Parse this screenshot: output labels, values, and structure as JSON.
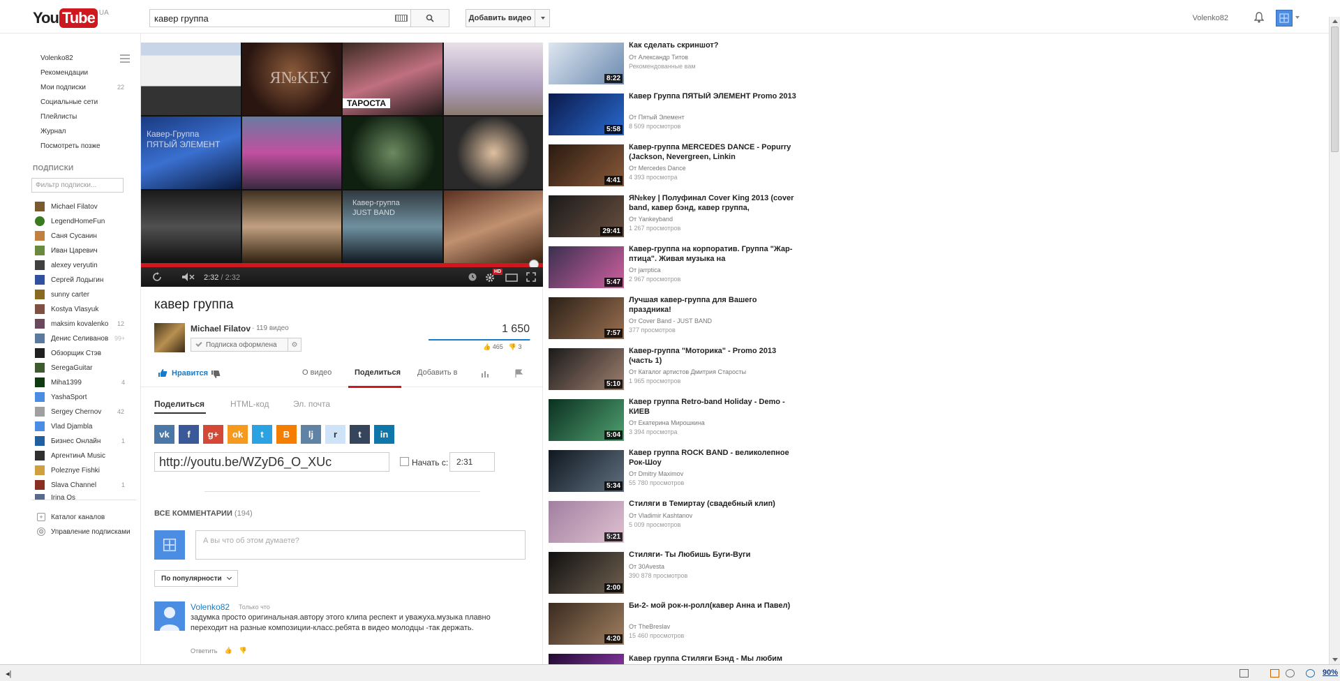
{
  "header": {
    "logo_you": "You",
    "logo_tube": "Tube",
    "logo_country": "UA",
    "search_value": "кавер группа",
    "upload_label": "Добавить видео",
    "username": "Volenko82"
  },
  "sidebar": {
    "nav": [
      {
        "label": "Volenko82",
        "count": ""
      },
      {
        "label": "Рекомендации",
        "count": ""
      },
      {
        "label": "Мои подписки",
        "count": "22"
      },
      {
        "label": "Социальные сети",
        "count": ""
      },
      {
        "label": "Плейлисты",
        "count": ""
      },
      {
        "label": "Журнал",
        "count": ""
      },
      {
        "label": "Посмотреть позже",
        "count": ""
      }
    ],
    "subs_header": "ПОДПИСКИ",
    "subs_filter_placeholder": "Фильтр подписки...",
    "subs": [
      {
        "name": "Michael Filatov",
        "count": "",
        "color": "#7a5a30"
      },
      {
        "name": "LegendHomeFun",
        "count": "",
        "color": "#3a7a20"
      },
      {
        "name": "Саня Сусанин",
        "count": "",
        "color": "#c08040"
      },
      {
        "name": "Иван Царевич",
        "count": "",
        "color": "#6a8a40"
      },
      {
        "name": "alexey veryutin",
        "count": "",
        "color": "#404040"
      },
      {
        "name": "Сергей Лодыгин",
        "count": "",
        "color": "#3050a0"
      },
      {
        "name": "sunny carter",
        "count": "",
        "color": "#8a6a20"
      },
      {
        "name": "Kostya Vlasyuk",
        "count": "",
        "color": "#805040"
      },
      {
        "name": "maksim kovalenko",
        "count": "12",
        "color": "#6a4a5a"
      },
      {
        "name": "Денис Селиванов",
        "count": "99+",
        "color": "#5a7aa0"
      },
      {
        "name": "Обзорщик Стэв",
        "count": "",
        "color": "#202020"
      },
      {
        "name": "SeregaGuitar",
        "count": "",
        "color": "#405a30"
      },
      {
        "name": "Miha1399",
        "count": "4",
        "color": "#103a10"
      },
      {
        "name": "YashaSport",
        "count": "",
        "color": "#4b8de2"
      },
      {
        "name": "Sergey Chernov",
        "count": "42",
        "color": "#a0a0a0"
      },
      {
        "name": "Vlad Djambla",
        "count": "",
        "color": "#4b8de2"
      },
      {
        "name": "Бизнес Онлайн",
        "count": "1",
        "color": "#2060a0"
      },
      {
        "name": "АргентинА Music",
        "count": "",
        "color": "#303030"
      },
      {
        "name": "Poleznye Fishki",
        "count": "",
        "color": "#d0a040"
      },
      {
        "name": "Slava Channel",
        "count": "1",
        "color": "#8a3020"
      },
      {
        "name": "Irina Os",
        "count": "",
        "color": "#5a6a8a"
      }
    ],
    "bottom": [
      {
        "label": "Каталог каналов"
      },
      {
        "label": "Управление подписками"
      }
    ]
  },
  "player": {
    "current_time": "2:32",
    "duration": "/ 2:32",
    "hd_badge": "HD",
    "overlay_1": "Кавер-Группа",
    "overlay_2": "ПЯТЫЙ ЭЛЕМЕНТ",
    "overlay_3": "Кавер-группа",
    "overlay_4": "JUST BAND",
    "overlay_5": "ТАРОСТА",
    "overlay_6": "Я№KEY",
    "progress_fraction": 1.0
  },
  "video": {
    "title": "кавер группа",
    "channel": "Michael Filatov",
    "channel_videos": "· 119 видео",
    "subscribe_label": "Подписка оформлена",
    "views": "1 650",
    "likes": "465",
    "dislikes": "3",
    "like_label": "Нравится",
    "tabs": [
      "О видео",
      "Поделиться",
      "Добавить в"
    ],
    "share_tabs": [
      "Поделиться",
      "HTML-код",
      "Эл. почта"
    ],
    "share_url": "http://youtu.be/WZyD6_O_XUc",
    "start_label": "Начать с:",
    "start_value": "2:31",
    "social": [
      {
        "icon": "vk-icon",
        "glyph": "vk",
        "color": "#4a76a8"
      },
      {
        "icon": "facebook-icon",
        "glyph": "f",
        "color": "#3b5998"
      },
      {
        "icon": "googleplus-icon",
        "glyph": "g+",
        "color": "#d34836"
      },
      {
        "icon": "odnoklassniki-icon",
        "glyph": "ok",
        "color": "#f59a1e"
      },
      {
        "icon": "twitter-icon",
        "glyph": "t",
        "color": "#2ba2e2"
      },
      {
        "icon": "blogger-icon",
        "glyph": "B",
        "color": "#f57d00"
      },
      {
        "icon": "livejournal-icon",
        "glyph": "lj",
        "color": "#6082a5"
      },
      {
        "icon": "reddit-icon",
        "glyph": "r",
        "color": "#cee3f8"
      },
      {
        "icon": "tumblr-icon",
        "glyph": "t",
        "color": "#35465c"
      },
      {
        "icon": "linkedin-icon",
        "glyph": "in",
        "color": "#0e76a8"
      }
    ]
  },
  "comments": {
    "header": "ВСЕ КОММЕНТАРИИ",
    "count": "(194)",
    "placeholder": "А вы что об этом думаете?",
    "sort_label": "По популярности",
    "items": [
      {
        "author": "Volenko82",
        "time": "Только что",
        "text": "задумка просто оригинальная.автору этого клипа респект и уважуха.музыка плавно переходит на разные композиции-класс.ребята в видео молодцы -так держать.",
        "reply": "Ответить"
      }
    ]
  },
  "related": [
    {
      "title": "Как сделать скриншот?",
      "by": "От Александр Титов",
      "views": "Рекомендованные вам",
      "duration": "8:22",
      "c1": "#dfe6f0",
      "c2": "#6a8ab0"
    },
    {
      "title": "Кавер Группа ПЯТЫЙ ЭЛЕМЕНТ Promo 2013",
      "by": "От Пятый Элемент",
      "views": "8 509 просмотров",
      "duration": "5:58",
      "c1": "#0a1a4a",
      "c2": "#2a6ad0"
    },
    {
      "title": "Кавер-группа MERCEDES DANCE - Popurry (Jackson, Nevergreen, Linkin",
      "by": "От Mercedes Dance",
      "views": "4 393 просмотра",
      "duration": "4:41",
      "c1": "#2a1a10",
      "c2": "#8a5a3a"
    },
    {
      "title": "Я№key | Полуфинал Cover King 2013 (cover band, кавер бэнд, кавер группа,",
      "by": "От Yankeyband",
      "views": "1 267 просмотров",
      "duration": "29:41",
      "c1": "#1a1a1a",
      "c2": "#6a5040"
    },
    {
      "title": "Кавер-группа на корпоратив. Группа \"Жар-птица\". Живая музыка на",
      "by": "От jarrptica",
      "views": "2 967 просмотров",
      "duration": "5:47",
      "c1": "#3a3050",
      "c2": "#d060a0"
    },
    {
      "title": "Лучшая кавер-группа для Вашего праздника!",
      "by": "От Cover Band - JUST BAND",
      "views": "377 просмотров",
      "duration": "7:57",
      "c1": "#2a2018",
      "c2": "#9a7050"
    },
    {
      "title": "Кавер-группа \"Моторика\" - Promo 2013 (часть 1)",
      "by": "От Каталог артистов Дмитрия Старосты",
      "views": "1 965 просмотров",
      "duration": "5:10",
      "c1": "#1a1a1a",
      "c2": "#a08070"
    },
    {
      "title": "Кавер группа Retro-band Holiday - Demo - КИЕВ",
      "by": "От Екатерина Мирошкина",
      "views": "3 394 просмотра",
      "duration": "5:04",
      "c1": "#0a3020",
      "c2": "#50a070"
    },
    {
      "title": "Кавер группа ROCK BAND - великолепное Рок-Шоу",
      "by": "От Dmitry Maximov",
      "views": "55 780 просмотров",
      "duration": "5:34",
      "c1": "#101820",
      "c2": "#607080"
    },
    {
      "title": "Стиляги в Темиртау (свадебный клип)",
      "by": "От Vladimir Kashtanov",
      "views": "5 009 просмотров",
      "duration": "5:21",
      "c1": "#a080a0",
      "c2": "#e0c0d0"
    },
    {
      "title": "Стиляги- Ты Любишь Буги-Вуги",
      "by": "От 30Avesta",
      "views": "390 878 просмотров",
      "duration": "2:00",
      "c1": "#101010",
      "c2": "#706050"
    },
    {
      "title": "Би-2- мой рок-н-ролл(кавер Анна и Павел)",
      "by": "От TheBreslav",
      "views": "15 460 просмотров",
      "duration": "4:20",
      "c1": "#3a2a20",
      "c2": "#a08060"
    },
    {
      "title": "Кавер группа Стиляги Бэнд - Мы любим",
      "by": "",
      "views": "",
      "duration": "",
      "c1": "#200a30",
      "c2": "#a040c0"
    }
  ],
  "statusbar": {
    "zoom": "90%"
  }
}
